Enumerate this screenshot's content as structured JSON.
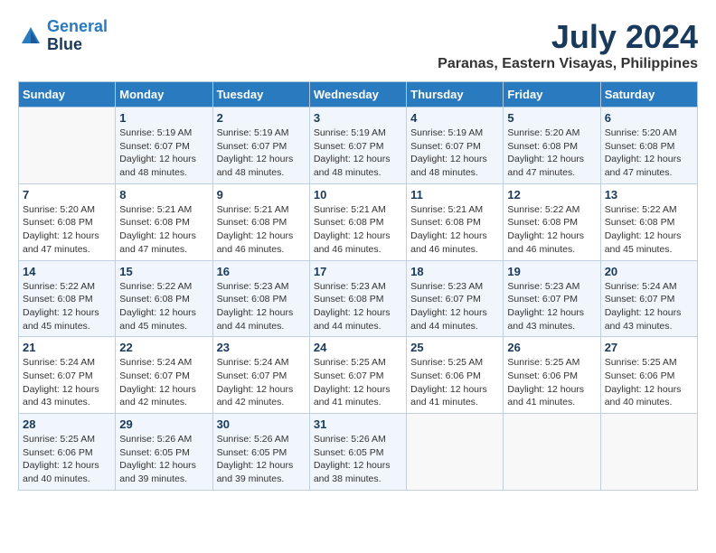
{
  "logo": {
    "line1": "General",
    "line2": "Blue"
  },
  "title": {
    "month_year": "July 2024",
    "location": "Paranas, Eastern Visayas, Philippines"
  },
  "headers": [
    "Sunday",
    "Monday",
    "Tuesday",
    "Wednesday",
    "Thursday",
    "Friday",
    "Saturday"
  ],
  "weeks": [
    [
      {
        "day": "",
        "info": ""
      },
      {
        "day": "1",
        "info": "Sunrise: 5:19 AM\nSunset: 6:07 PM\nDaylight: 12 hours\nand 48 minutes."
      },
      {
        "day": "2",
        "info": "Sunrise: 5:19 AM\nSunset: 6:07 PM\nDaylight: 12 hours\nand 48 minutes."
      },
      {
        "day": "3",
        "info": "Sunrise: 5:19 AM\nSunset: 6:07 PM\nDaylight: 12 hours\nand 48 minutes."
      },
      {
        "day": "4",
        "info": "Sunrise: 5:19 AM\nSunset: 6:07 PM\nDaylight: 12 hours\nand 48 minutes."
      },
      {
        "day": "5",
        "info": "Sunrise: 5:20 AM\nSunset: 6:08 PM\nDaylight: 12 hours\nand 47 minutes."
      },
      {
        "day": "6",
        "info": "Sunrise: 5:20 AM\nSunset: 6:08 PM\nDaylight: 12 hours\nand 47 minutes."
      }
    ],
    [
      {
        "day": "7",
        "info": "Sunrise: 5:20 AM\nSunset: 6:08 PM\nDaylight: 12 hours\nand 47 minutes."
      },
      {
        "day": "8",
        "info": "Sunrise: 5:21 AM\nSunset: 6:08 PM\nDaylight: 12 hours\nand 47 minutes."
      },
      {
        "day": "9",
        "info": "Sunrise: 5:21 AM\nSunset: 6:08 PM\nDaylight: 12 hours\nand 46 minutes."
      },
      {
        "day": "10",
        "info": "Sunrise: 5:21 AM\nSunset: 6:08 PM\nDaylight: 12 hours\nand 46 minutes."
      },
      {
        "day": "11",
        "info": "Sunrise: 5:21 AM\nSunset: 6:08 PM\nDaylight: 12 hours\nand 46 minutes."
      },
      {
        "day": "12",
        "info": "Sunrise: 5:22 AM\nSunset: 6:08 PM\nDaylight: 12 hours\nand 46 minutes."
      },
      {
        "day": "13",
        "info": "Sunrise: 5:22 AM\nSunset: 6:08 PM\nDaylight: 12 hours\nand 45 minutes."
      }
    ],
    [
      {
        "day": "14",
        "info": "Sunrise: 5:22 AM\nSunset: 6:08 PM\nDaylight: 12 hours\nand 45 minutes."
      },
      {
        "day": "15",
        "info": "Sunrise: 5:22 AM\nSunset: 6:08 PM\nDaylight: 12 hours\nand 45 minutes."
      },
      {
        "day": "16",
        "info": "Sunrise: 5:23 AM\nSunset: 6:08 PM\nDaylight: 12 hours\nand 44 minutes."
      },
      {
        "day": "17",
        "info": "Sunrise: 5:23 AM\nSunset: 6:08 PM\nDaylight: 12 hours\nand 44 minutes."
      },
      {
        "day": "18",
        "info": "Sunrise: 5:23 AM\nSunset: 6:07 PM\nDaylight: 12 hours\nand 44 minutes."
      },
      {
        "day": "19",
        "info": "Sunrise: 5:23 AM\nSunset: 6:07 PM\nDaylight: 12 hours\nand 43 minutes."
      },
      {
        "day": "20",
        "info": "Sunrise: 5:24 AM\nSunset: 6:07 PM\nDaylight: 12 hours\nand 43 minutes."
      }
    ],
    [
      {
        "day": "21",
        "info": "Sunrise: 5:24 AM\nSunset: 6:07 PM\nDaylight: 12 hours\nand 43 minutes."
      },
      {
        "day": "22",
        "info": "Sunrise: 5:24 AM\nSunset: 6:07 PM\nDaylight: 12 hours\nand 42 minutes."
      },
      {
        "day": "23",
        "info": "Sunrise: 5:24 AM\nSunset: 6:07 PM\nDaylight: 12 hours\nand 42 minutes."
      },
      {
        "day": "24",
        "info": "Sunrise: 5:25 AM\nSunset: 6:07 PM\nDaylight: 12 hours\nand 41 minutes."
      },
      {
        "day": "25",
        "info": "Sunrise: 5:25 AM\nSunset: 6:06 PM\nDaylight: 12 hours\nand 41 minutes."
      },
      {
        "day": "26",
        "info": "Sunrise: 5:25 AM\nSunset: 6:06 PM\nDaylight: 12 hours\nand 41 minutes."
      },
      {
        "day": "27",
        "info": "Sunrise: 5:25 AM\nSunset: 6:06 PM\nDaylight: 12 hours\nand 40 minutes."
      }
    ],
    [
      {
        "day": "28",
        "info": "Sunrise: 5:25 AM\nSunset: 6:06 PM\nDaylight: 12 hours\nand 40 minutes."
      },
      {
        "day": "29",
        "info": "Sunrise: 5:26 AM\nSunset: 6:05 PM\nDaylight: 12 hours\nand 39 minutes."
      },
      {
        "day": "30",
        "info": "Sunrise: 5:26 AM\nSunset: 6:05 PM\nDaylight: 12 hours\nand 39 minutes."
      },
      {
        "day": "31",
        "info": "Sunrise: 5:26 AM\nSunset: 6:05 PM\nDaylight: 12 hours\nand 38 minutes."
      },
      {
        "day": "",
        "info": ""
      },
      {
        "day": "",
        "info": ""
      },
      {
        "day": "",
        "info": ""
      }
    ]
  ]
}
